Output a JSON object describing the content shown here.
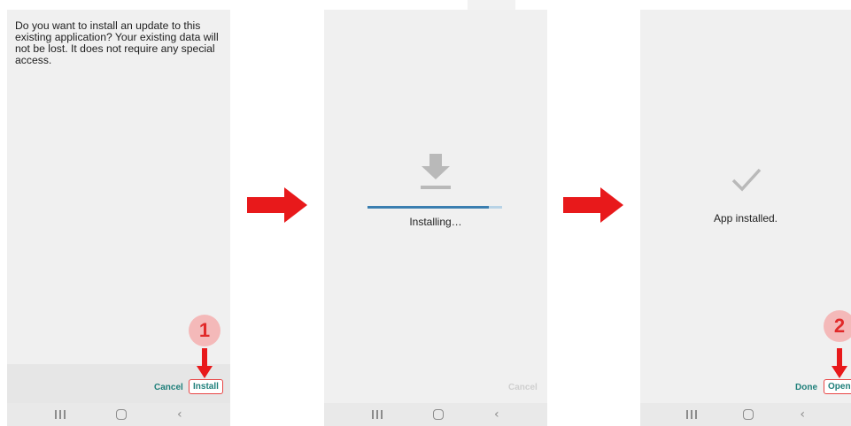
{
  "screen1": {
    "message": "Do you want to install an update to this existing application? Your existing data will not be lost. It does not require any special access.",
    "cancel_label": "Cancel",
    "install_label": "Install"
  },
  "screen2": {
    "status": "Installing…",
    "progress": 0.9,
    "cancel_label": "Cancel"
  },
  "screen3": {
    "status": "App installed.",
    "done_label": "Done",
    "open_label": "Open"
  },
  "steps": [
    "1",
    "2"
  ],
  "nav": {
    "back_glyph": "‹"
  },
  "colors": {
    "accent_text": "#1e7f7a",
    "highlight_red": "#e84545",
    "arrow_red": "#e8191b",
    "badge_bg": "#f4b9b9",
    "progress": "#3a7eb0"
  },
  "icons": [
    "download-icon",
    "checkmark-icon",
    "arrow-right-icon",
    "arrow-down-icon",
    "recents-icon",
    "home-icon",
    "back-icon"
  ]
}
